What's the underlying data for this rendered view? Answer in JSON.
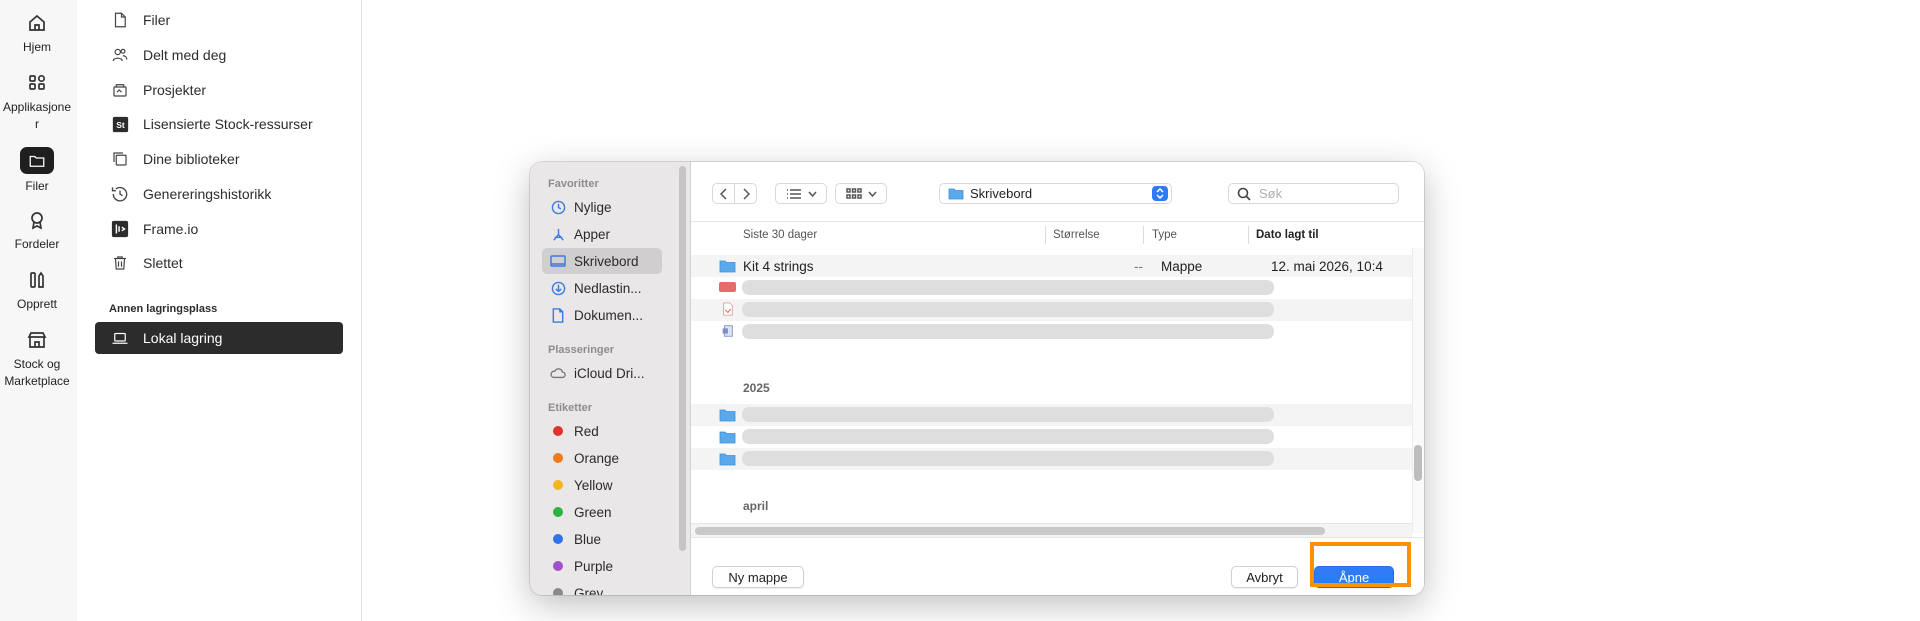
{
  "rail": {
    "items": [
      {
        "label": "Hjem",
        "icon": "home-icon"
      },
      {
        "label": "Applikasjone\nr",
        "icon": "apps-icon"
      },
      {
        "label": "Filer",
        "icon": "folder-icon"
      },
      {
        "label": "Fordeler",
        "icon": "award-icon"
      },
      {
        "label": "Opprett",
        "icon": "create-icon"
      },
      {
        "label": "Stock og\nMarketplace",
        "icon": "store-icon"
      }
    ]
  },
  "nav": {
    "items": [
      {
        "label": "Filer",
        "icon": "file-icon"
      },
      {
        "label": "Delt med deg",
        "icon": "shared-icon"
      },
      {
        "label": "Prosjekter",
        "icon": "projects-icon"
      },
      {
        "label": "Lisensierte Stock-ressurser",
        "icon": "stock-icon"
      },
      {
        "label": "Dine biblioteker",
        "icon": "library-icon"
      },
      {
        "label": "Genereringshistorikk",
        "icon": "history-icon"
      },
      {
        "label": "Frame.io",
        "icon": "frameio-icon"
      },
      {
        "label": "Slettet",
        "icon": "trash-icon"
      }
    ],
    "section_label": "Annen lagringsplass",
    "active_item": "Lokal lagring"
  },
  "dialog": {
    "sidebar": {
      "favorites_header": "Favoritter",
      "favorites": [
        "Nylige",
        "Apper",
        "Skrivebord",
        "Nedlastin...",
        "Dokumen..."
      ],
      "places_header": "Plasseringer",
      "places": [
        "iCloud Dri..."
      ],
      "tags_header": "Etiketter",
      "tags": [
        {
          "label": "Red",
          "color": "#e0312b"
        },
        {
          "label": "Orange",
          "color": "#ee7a1b"
        },
        {
          "label": "Yellow",
          "color": "#f2b51f"
        },
        {
          "label": "Green",
          "color": "#2bb53c"
        },
        {
          "label": "Blue",
          "color": "#2f73e8"
        },
        {
          "label": "Purple",
          "color": "#a24fc9"
        },
        {
          "label": "Grey",
          "color": "#8a8a8a"
        }
      ]
    },
    "toolbar": {
      "location": "Skrivebord",
      "search_placeholder": "Søk"
    },
    "columns": {
      "name": "Siste 30 dager",
      "size": "Størrelse",
      "type": "Type",
      "date": "Dato lagt til"
    },
    "rows": [
      {
        "name": "Kit 4 strings",
        "size": "--",
        "type": "Mappe",
        "date": "12. mai 2026, 10:4"
      }
    ],
    "groups": [
      "2025",
      "april"
    ],
    "footer": {
      "new_folder": "Ny mappe",
      "cancel": "Avbryt",
      "open": "Åpne"
    }
  },
  "colors": {
    "accent": "#2f7bf5",
    "highlight": "#f59400"
  }
}
